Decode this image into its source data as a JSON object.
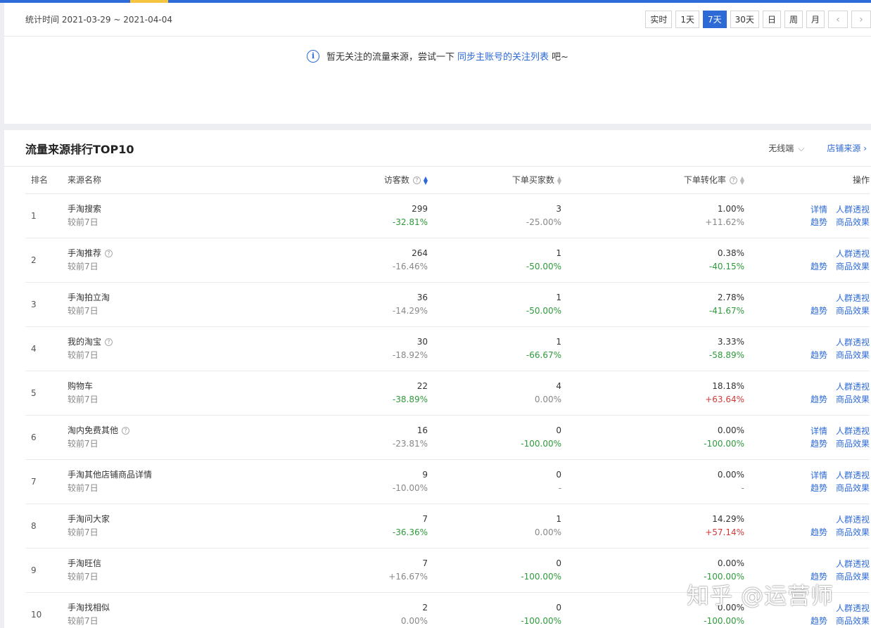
{
  "header": {
    "stat_label": "统计时间 2021-03-29 ~ 2021-04-04",
    "buttons": [
      "实时",
      "1天",
      "7天",
      "30天",
      "日",
      "周",
      "月"
    ],
    "active_button": "7天",
    "prev_arrow": "‹",
    "next_arrow": "›"
  },
  "notice": {
    "text_before": "暂无关注的流量来源，尝试一下",
    "link_text": "同步主账号的关注列表",
    "text_after": "吧~"
  },
  "ranking": {
    "title": "流量来源排行TOP10",
    "device_select": "无线端",
    "store_link": "店铺来源",
    "columns": {
      "rank": "排名",
      "name": "来源名称",
      "visitors": "访客数",
      "buyers": "下单买家数",
      "conversion": "下单转化率",
      "operation": "操作"
    },
    "compare_label": "较前7日",
    "op_labels": {
      "detail": "详情",
      "crowd": "人群透视",
      "trend": "趋势",
      "goods": "商品效果"
    },
    "rows": [
      {
        "rank": "1",
        "name": "手淘搜索",
        "help": false,
        "visitors": "299",
        "visitors_change": "-32.81%",
        "visitors_tone": "neg",
        "buyers": "3",
        "buyers_change": "-25.00%",
        "buyers_tone": "neu",
        "conv": "1.00%",
        "conv_change": "+11.62%",
        "conv_tone": "neu",
        "detail": true
      },
      {
        "rank": "2",
        "name": "手淘推荐",
        "help": true,
        "visitors": "264",
        "visitors_change": "-16.46%",
        "visitors_tone": "neu",
        "buyers": "1",
        "buyers_change": "-50.00%",
        "buyers_tone": "neg",
        "conv": "0.38%",
        "conv_change": "-40.15%",
        "conv_tone": "neg",
        "detail": false
      },
      {
        "rank": "3",
        "name": "手淘拍立淘",
        "help": false,
        "visitors": "36",
        "visitors_change": "-14.29%",
        "visitors_tone": "neu",
        "buyers": "1",
        "buyers_change": "-50.00%",
        "buyers_tone": "neg",
        "conv": "2.78%",
        "conv_change": "-41.67%",
        "conv_tone": "neg",
        "detail": false
      },
      {
        "rank": "4",
        "name": "我的淘宝",
        "help": true,
        "visitors": "30",
        "visitors_change": "-18.92%",
        "visitors_tone": "neu",
        "buyers": "1",
        "buyers_change": "-66.67%",
        "buyers_tone": "neg",
        "conv": "3.33%",
        "conv_change": "-58.89%",
        "conv_tone": "neg",
        "detail": false
      },
      {
        "rank": "5",
        "name": "购物车",
        "help": false,
        "visitors": "22",
        "visitors_change": "-38.89%",
        "visitors_tone": "neg",
        "buyers": "4",
        "buyers_change": "0.00%",
        "buyers_tone": "neu",
        "conv": "18.18%",
        "conv_change": "+63.64%",
        "conv_tone": "pos",
        "detail": false
      },
      {
        "rank": "6",
        "name": "淘内免费其他",
        "help": true,
        "visitors": "16",
        "visitors_change": "-23.81%",
        "visitors_tone": "neu",
        "buyers": "0",
        "buyers_change": "-100.00%",
        "buyers_tone": "neg",
        "conv": "0.00%",
        "conv_change": "-100.00%",
        "conv_tone": "neg",
        "detail": true
      },
      {
        "rank": "7",
        "name": "手淘其他店铺商品详情",
        "help": false,
        "visitors": "9",
        "visitors_change": "-10.00%",
        "visitors_tone": "neu",
        "buyers": "0",
        "buyers_change": "-",
        "buyers_tone": "neu",
        "conv": "0.00%",
        "conv_change": "-",
        "conv_tone": "neu",
        "detail": true
      },
      {
        "rank": "8",
        "name": "手淘问大家",
        "help": false,
        "visitors": "7",
        "visitors_change": "-36.36%",
        "visitors_tone": "neg",
        "buyers": "1",
        "buyers_change": "0.00%",
        "buyers_tone": "neu",
        "conv": "14.29%",
        "conv_change": "+57.14%",
        "conv_tone": "pos",
        "detail": false
      },
      {
        "rank": "9",
        "name": "手淘旺信",
        "help": false,
        "visitors": "7",
        "visitors_change": "+16.67%",
        "visitors_tone": "neu",
        "buyers": "0",
        "buyers_change": "-100.00%",
        "buyers_tone": "neg",
        "conv": "0.00%",
        "conv_change": "-100.00%",
        "conv_tone": "neg",
        "detail": false
      },
      {
        "rank": "10",
        "name": "手淘找相似",
        "help": false,
        "visitors": "2",
        "visitors_change": "0.00%",
        "visitors_tone": "neu",
        "buyers": "0",
        "buyers_change": "-100.00%",
        "buyers_tone": "neg",
        "conv": "0.00%",
        "conv_change": "-100.00%",
        "conv_tone": "neg",
        "detail": false
      }
    ]
  },
  "watermark": "知乎 @运营师",
  "colors": {
    "accent": "#2d6ad6",
    "positive": "#d23a3a",
    "negative": "#2e9a3b",
    "muted": "#888888"
  }
}
